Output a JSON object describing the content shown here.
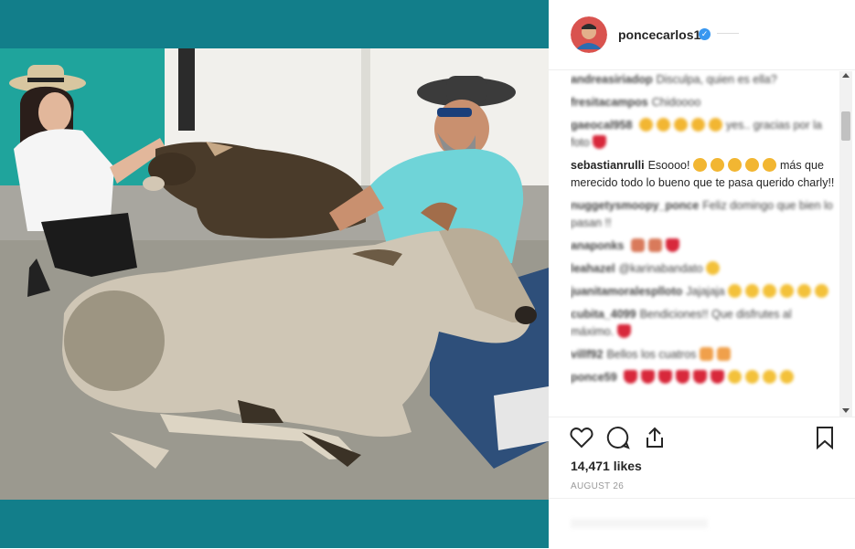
{
  "post": {
    "username": "poncecarlos1",
    "verified_label": "✓",
    "likes": "14,471 likes",
    "date": "AUGUST 26"
  },
  "comments": [
    {
      "user": "andreasiriadop",
      "text": "Disculpa, quien es ella?",
      "blurred": true
    },
    {
      "user": "fresitacampos",
      "text": "Chidoooo",
      "blurred": true
    },
    {
      "user": "gaeocal958",
      "text": "yes.. gracias por la foto",
      "blurred": true
    },
    {
      "user": "sebastianrulli",
      "text_before": "Esoooo!",
      "text_after": "más que merecido todo lo bueno que te pasa querido charly!!",
      "blurred": false
    },
    {
      "user": "nuggetysmoopy_ponce",
      "text": "Feliz domingo que bien lo pasan !!",
      "blurred": true
    },
    {
      "user": "anaponks",
      "text": "",
      "blurred": true
    },
    {
      "user": "leahazel",
      "text": "@karinabandato",
      "blurred": true
    },
    {
      "user": "juanitamoralesplloto",
      "text": "Jajajaja",
      "blurred": true
    },
    {
      "user": "cubita_4099",
      "text": "Bendiciones!! Que disfrutes al máximo.",
      "blurred": true
    },
    {
      "user": "villf92",
      "text": "Bellos los cuatros",
      "blurred": true
    },
    {
      "user": "ponce59",
      "text": "",
      "blurred": true
    }
  ],
  "icons": {
    "like": "heart-icon",
    "comment": "comment-bubble-icon",
    "share": "share-icon",
    "save": "bookmark-icon",
    "verified": "verified-badge-icon"
  },
  "colors": {
    "media_bg": "#127e8a",
    "verified": "#3897f0",
    "text": "#262626",
    "muted": "#999999"
  }
}
